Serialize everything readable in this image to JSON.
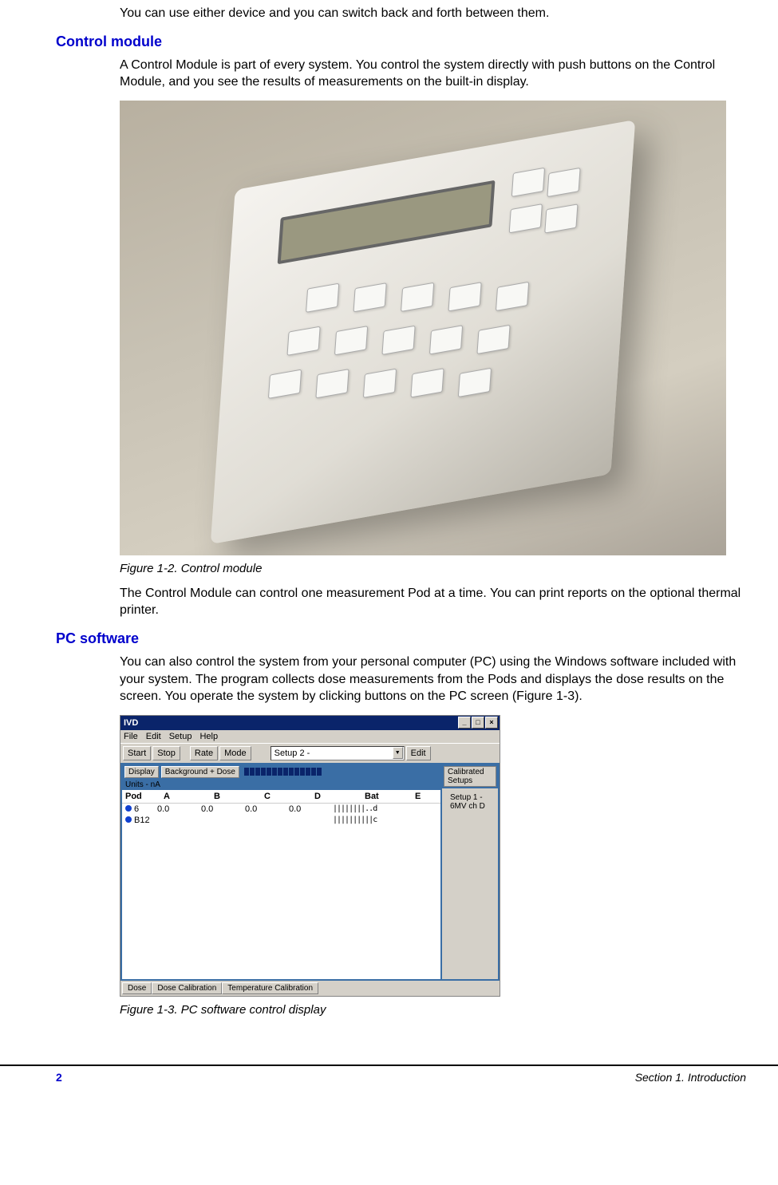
{
  "intro": "You can use either device and you can switch back and forth between them.",
  "section1": {
    "heading": "Control module",
    "p1": "A Control Module is part of every system. You control the system directly with push buttons on the Control Module, and you see the results of measurements on the built-in display.",
    "caption": "Figure 1-2. Control module",
    "p2": "The Control Module can control one measurement Pod at a time. You can print reports on the optional thermal printer."
  },
  "section2": {
    "heading": "PC software",
    "p1": "You can also control the system from your personal computer (PC) using the Windows software included with your system. The program collects dose measurements from the Pods and displays the dose results on the screen. You operate the system by clicking buttons on the PC screen (Figure 1-3).",
    "caption": "Figure 1-3. PC software control display"
  },
  "sw": {
    "title": "IVD",
    "menu": {
      "file": "File",
      "edit": "Edit",
      "setup": "Setup",
      "help": "Help"
    },
    "toolbar": {
      "start": "Start",
      "stop": "Stop",
      "rate": "Rate",
      "mode": "Mode",
      "setup_sel": "Setup 2 -",
      "edit": "Edit"
    },
    "bar": {
      "display": "Display",
      "bg": "Background + Dose"
    },
    "units": "Units - nA",
    "cols": {
      "pod": "Pod",
      "a": "A",
      "b": "B",
      "c": "C",
      "d": "D",
      "bat": "Bat",
      "e": "E"
    },
    "rows": [
      {
        "pod": "6",
        "a": "0.0",
        "b": "0.0",
        "c": "0.0",
        "d": "0.0",
        "bat": "||||||||..d"
      },
      {
        "pod": "B12",
        "a": "",
        "b": "",
        "c": "",
        "d": "",
        "bat": "||||||||||c"
      }
    ],
    "right": {
      "title": "Calibrated Setups",
      "item": "Setup 1 - 6MV ch D"
    },
    "tabs": {
      "dose": "Dose",
      "dcal": "Dose Calibration",
      "tcal": "Temperature Calibration"
    }
  },
  "footer": {
    "page": "2",
    "section": "Section 1. Introduction"
  }
}
